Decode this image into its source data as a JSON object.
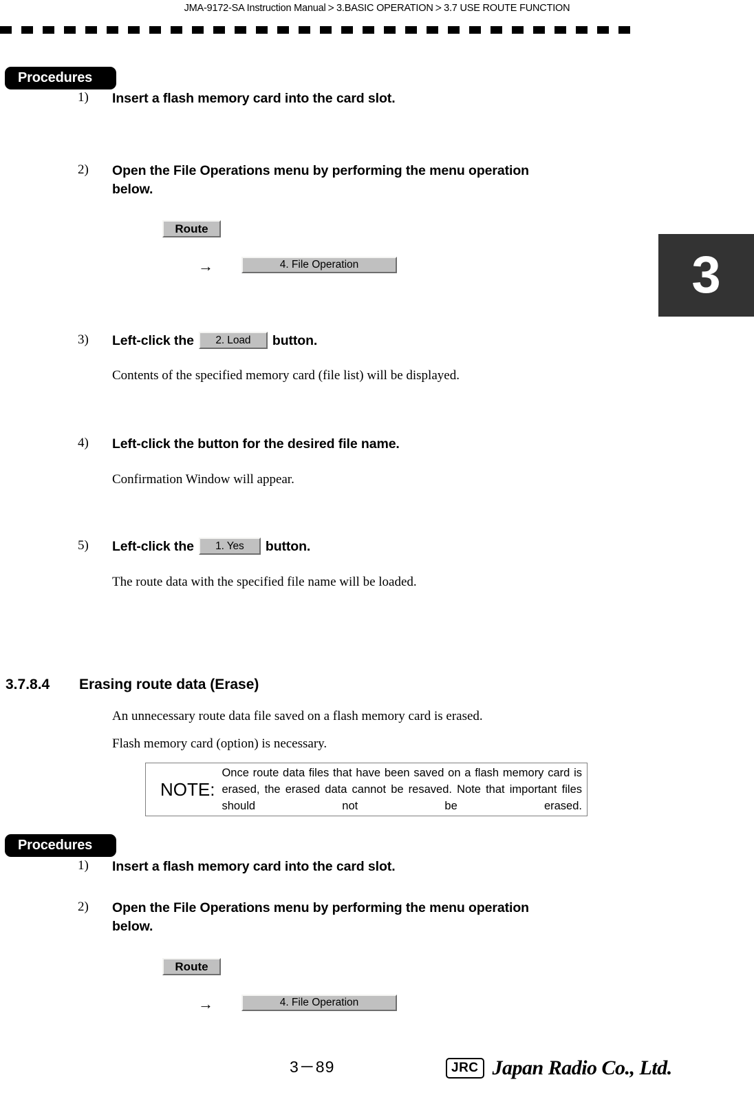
{
  "header": {
    "crumb1": "JMA-9172-SA Instruction Manual",
    "crumb2": "3.BASIC OPERATION",
    "crumb3": "3.7  USE ROUTE FUNCTION",
    "separator": ">"
  },
  "chapter_tab": {
    "number": "3"
  },
  "section_a": {
    "procedures_label": "Procedures",
    "steps": [
      {
        "num": "1)",
        "text": "Insert a flash memory card into the card slot."
      },
      {
        "num": "2)",
        "text": "Open the File Operations menu by performing the menu operation below."
      },
      {
        "num": "3)",
        "pre": "Left-click the",
        "button": "2. Load",
        "post": "button."
      },
      {
        "num": "4)",
        "text": "Left-click the button for the desired file name."
      },
      {
        "num": "5)",
        "pre": "Left-click the",
        "button": "1. Yes",
        "post": "button."
      }
    ],
    "menu_route": "Route",
    "menu_arrow": "→",
    "menu_fileop": "4. File Operation",
    "note_step3": "Contents of the specified memory card (file list) will be displayed.",
    "note_step4": "Confirmation Window will appear.",
    "note_step5": "The route data with the specified file name will be loaded."
  },
  "section_b": {
    "number": "3.7.8.4",
    "title": "Erasing route data (Erase)",
    "body1": "An unnecessary route data file saved on a flash memory card is erased.",
    "body2": "Flash memory card (option) is necessary.",
    "note_label": "NOTE:",
    "note_text": "Once route data files that have been saved on a flash memory card is erased, the erased data cannot be resaved. Note that important files should not be erased.",
    "procedures_label": "Procedures",
    "steps": [
      {
        "num": "1)",
        "text": "Insert a flash memory card into the card slot."
      },
      {
        "num": "2)",
        "text": "Open the File Operations menu by performing the menu operation below."
      }
    ],
    "menu_route": "Route",
    "menu_arrow": "→",
    "menu_fileop": "4. File Operation"
  },
  "footer": {
    "page_number": "3－89",
    "logo_mark": "JRC",
    "company": "Japan Radio Co., Ltd."
  }
}
